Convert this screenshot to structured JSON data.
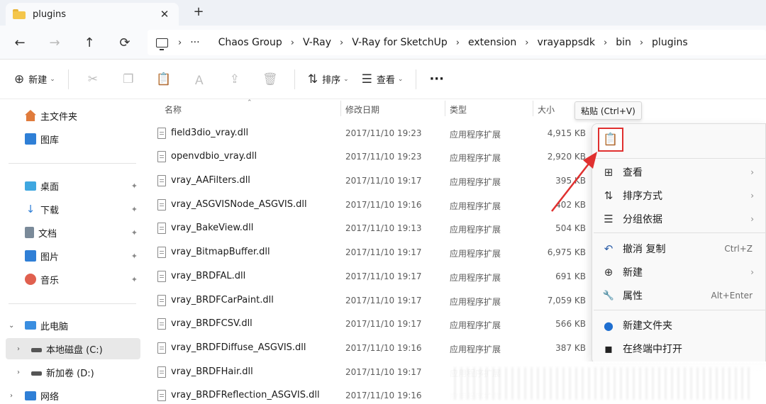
{
  "window": {
    "tab_title": "plugins",
    "tab_close_glyph": "✕",
    "new_tab_glyph": "+"
  },
  "nav": {
    "back_glyph": "←",
    "forward_glyph": "→",
    "up_glyph": "↑",
    "refresh_glyph": "⟳",
    "breadcrumb_sep": "›",
    "more_glyph": "···",
    "breadcrumbs": [
      "Chaos Group",
      "V-Ray",
      "V-Ray for SketchUp",
      "extension",
      "vrayappsdk",
      "bin",
      "plugins"
    ]
  },
  "toolbar": {
    "new_label": "新建",
    "sort_label": "排序",
    "view_label": "查看",
    "more_glyph": "···",
    "caret": "⌄",
    "icons": [
      "new-icon",
      "cut-icon",
      "copy-icon",
      "paste-icon",
      "rename-icon",
      "share-icon",
      "delete-icon",
      "sort-icon",
      "view-icon",
      "more-icon"
    ]
  },
  "sidebar": {
    "items": [
      {
        "label": "主文件夹",
        "icon": "home-icon",
        "color": "#e07b3c"
      },
      {
        "label": "图库",
        "icon": "gallery-icon",
        "color": "#2f7fd6"
      },
      {
        "label": "桌面",
        "icon": "desktop-icon",
        "color": "#3fa7e0",
        "pinned": true
      },
      {
        "label": "下载",
        "icon": "download-icon",
        "color": "#2f7fd6",
        "pinned": true
      },
      {
        "label": "文档",
        "icon": "documents-icon",
        "color": "#7a8a99",
        "pinned": true
      },
      {
        "label": "图片",
        "icon": "pictures-icon",
        "color": "#2f7fd6",
        "pinned": true
      },
      {
        "label": "音乐",
        "icon": "music-icon",
        "color": "#e0604f",
        "pinned": true
      },
      {
        "label": "此电脑",
        "icon": "this-pc-icon",
        "color": "#3a8ee0"
      },
      {
        "label": "本地磁盘 (C:)",
        "icon": "drive-c-icon",
        "color": "#555555"
      },
      {
        "label": "新加卷 (D:)",
        "icon": "drive-d-icon",
        "color": "#555555"
      },
      {
        "label": "网络",
        "icon": "network-icon",
        "color": "#2f7fd6"
      }
    ],
    "pin_glyph": "📌"
  },
  "columns": {
    "name": "名称",
    "date": "修改日期",
    "type": "类型",
    "size": "大小"
  },
  "files": [
    {
      "name": "field3dio_vray.dll",
      "date": "2017/11/10 19:23",
      "type": "应用程序扩展",
      "size": "4,915 KB"
    },
    {
      "name": "openvdbio_vray.dll",
      "date": "2017/11/10 19:23",
      "type": "应用程序扩展",
      "size": "2,920 KB"
    },
    {
      "name": "vray_AAFilters.dll",
      "date": "2017/11/10 19:17",
      "type": "应用程序扩展",
      "size": "395 KB"
    },
    {
      "name": "vray_ASGVISNode_ASGVIS.dll",
      "date": "2017/11/10 19:16",
      "type": "应用程序扩展",
      "size": "402 KB"
    },
    {
      "name": "vray_BakeView.dll",
      "date": "2017/11/10 19:13",
      "type": "应用程序扩展",
      "size": "504 KB"
    },
    {
      "name": "vray_BitmapBuffer.dll",
      "date": "2017/11/10 19:17",
      "type": "应用程序扩展",
      "size": "6,975 KB"
    },
    {
      "name": "vray_BRDFAL.dll",
      "date": "2017/11/10 19:17",
      "type": "应用程序扩展",
      "size": "691 KB"
    },
    {
      "name": "vray_BRDFCarPaint.dll",
      "date": "2017/11/10 19:17",
      "type": "应用程序扩展",
      "size": "7,059 KB"
    },
    {
      "name": "vray_BRDFCSV.dll",
      "date": "2017/11/10 19:17",
      "type": "应用程序扩展",
      "size": "566 KB"
    },
    {
      "name": "vray_BRDFDiffuse_ASGVIS.dll",
      "date": "2017/11/10 19:16",
      "type": "应用程序扩展",
      "size": "387 KB"
    },
    {
      "name": "vray_BRDFHair.dll",
      "date": "2017/11/10 19:17",
      "type": "应用程序扩展",
      "size": ""
    },
    {
      "name": "vray_BRDFReflection_ASGVIS.dll",
      "date": "2017/11/10 19:16",
      "type": "应用程序扩展",
      "size": ""
    }
  ],
  "tooltip": {
    "text": "粘贴 (Ctrl+V)"
  },
  "context_menu": {
    "paste_icon": "paste-icon",
    "items": [
      {
        "label": "查看",
        "icon": "view-grid-icon",
        "glyph": "⊞",
        "arrow": "›",
        "shortcut": ""
      },
      {
        "label": "排序方式",
        "icon": "sort-icon",
        "glyph": "⇅",
        "arrow": "›",
        "shortcut": ""
      },
      {
        "label": "分组依据",
        "icon": "group-by-icon",
        "glyph": "☰",
        "arrow": "›",
        "shortcut": ""
      },
      {
        "label": "撤消 复制",
        "icon": "undo-icon",
        "glyph": "↶",
        "arrow": "",
        "shortcut": "Ctrl+Z"
      },
      {
        "label": "新建",
        "icon": "new-icon",
        "glyph": "⊕",
        "arrow": "›",
        "shortcut": ""
      },
      {
        "label": "属性",
        "icon": "properties-icon",
        "glyph": "🔧",
        "arrow": "",
        "shortcut": "Alt+Enter"
      },
      {
        "label": "新建文件夹",
        "icon": "new-folder-icon",
        "glyph": "●",
        "arrow": "",
        "shortcut": ""
      },
      {
        "label": "在终端中打开",
        "icon": "terminal-icon",
        "glyph": "▪",
        "arrow": "",
        "shortcut": ""
      }
    ]
  },
  "colors": {
    "highlight_red": "#e0302f",
    "accent_blue": "#2c5ea8",
    "selected_bg": "#e8e8e8"
  }
}
